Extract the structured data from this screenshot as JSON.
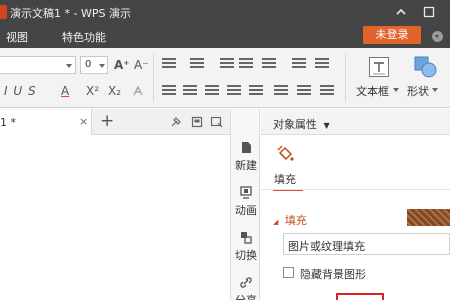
{
  "window": {
    "title": "演示文稿1 * - WPS 演示",
    "minimize_glyph": "^",
    "close_glyph": "□"
  },
  "menu": {
    "items": [
      "视图",
      "特色功能"
    ],
    "login_label": "未登录"
  },
  "ribbon": {
    "font_size_value": "0",
    "grow_font": "A⁺",
    "shrink_font": "A⁻",
    "bold_italic": "I  U  S",
    "font_color": "A",
    "superscript": "X²",
    "subscript": "X₂",
    "textbox_label": "文本框",
    "shape_label": "形状"
  },
  "doc_tabs": {
    "active_tab_label": "1 *",
    "close_glyph": "×",
    "add_glyph": "+"
  },
  "task_pane": {
    "items": [
      {
        "label": "新建",
        "icon": "new-slide-icon"
      },
      {
        "label": "动画",
        "icon": "animation-icon"
      },
      {
        "label": "切换",
        "icon": "transition-icon"
      },
      {
        "label": "分享",
        "icon": "share-link-icon"
      }
    ]
  },
  "properties": {
    "title": "对象属性",
    "tab_fill": "填充",
    "section_fill": "填充",
    "fill_type": "图片或纹理填充",
    "hide_background": "隐藏背景图形"
  },
  "colors": {
    "titlebar": "#454545",
    "accent": "#e0642c",
    "section_title": "#c25016",
    "highlight_box": "#e02020"
  }
}
